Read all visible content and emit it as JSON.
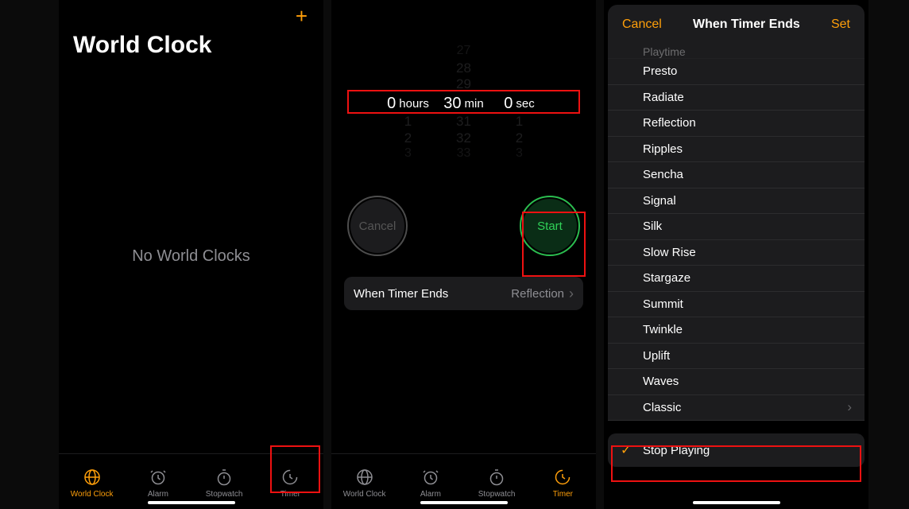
{
  "panel1": {
    "title": "World Clock",
    "empty": "No World Clocks",
    "tabs": [
      "World Clock",
      "Alarm",
      "Stopwatch",
      "Timer"
    ],
    "active_tab_index": 0,
    "highlighted_tab_index": 3
  },
  "panel2": {
    "picker": {
      "hours": {
        "selected": "0",
        "unit": "hours",
        "below": [
          "1",
          "2",
          "3"
        ]
      },
      "minutes": {
        "above": [
          "27",
          "28",
          "29"
        ],
        "selected": "30",
        "unit": "min",
        "below": [
          "31",
          "32",
          "33"
        ]
      },
      "seconds": {
        "selected": "0",
        "unit": "sec",
        "below": [
          "1",
          "2",
          "3"
        ]
      }
    },
    "cancel": "Cancel",
    "start": "Start",
    "when_label": "When Timer Ends",
    "when_value": "Reflection",
    "tabs": [
      "World Clock",
      "Alarm",
      "Stopwatch",
      "Timer"
    ],
    "active_tab_index": 3
  },
  "panel3": {
    "cancel": "Cancel",
    "title": "When Timer Ends",
    "set": "Set",
    "sounds_cut": "Playtime",
    "sounds": [
      "Presto",
      "Radiate",
      "Reflection",
      "Ripples",
      "Sencha",
      "Signal",
      "Silk",
      "Slow Rise",
      "Stargaze",
      "Summit",
      "Twinkle",
      "Uplift",
      "Waves"
    ],
    "classic": "Classic",
    "stop": "Stop Playing"
  }
}
